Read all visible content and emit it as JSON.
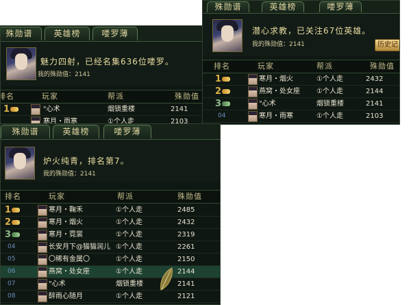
{
  "tabs": [
    "殊勋谱",
    "英雄榜",
    "喽罗薄"
  ],
  "headers": {
    "rank": "排名",
    "player": "玩家",
    "guild": "帮派",
    "value": "殊勋值"
  },
  "panel_a": {
    "message": "魅力四射，已经名集636位喽罗。",
    "my_value": "我的殊勋值：2141",
    "rows": [
      {
        "rank": "1",
        "player": "\"心术",
        "guild": "烟锁重楼",
        "value": "2141"
      },
      {
        "rank": "",
        "player": "寒月・雨寒",
        "guild": "①个人走",
        "value": "2103"
      }
    ]
  },
  "panel_b": {
    "message": "潜心求教，已关注67位英雄。",
    "my_value": "我的殊勋值：2141",
    "history_button": "历史记",
    "rows": [
      {
        "rank": "1",
        "player": "寒月・烟火",
        "guild": "①个人走",
        "value": "2432"
      },
      {
        "rank": "2",
        "player": "燕窝・处女座",
        "guild": "①个人走",
        "value": "2144"
      },
      {
        "rank": "3",
        "player": "\"心术",
        "guild": "烟锁重楼",
        "value": "2141"
      },
      {
        "rank": "04",
        "player": "寒月・雨寒",
        "guild": "①个人走",
        "value": "2103"
      }
    ]
  },
  "panel_c": {
    "message": "炉火纯青，排名第7。",
    "my_value": "我的殊勋值：2141",
    "rows": [
      {
        "rank": "1",
        "player": "寒月・鞠禾",
        "guild": "①个人走",
        "value": "2485"
      },
      {
        "rank": "2",
        "player": "寒月・烟火",
        "guild": "①个人走",
        "value": "2432"
      },
      {
        "rank": "3",
        "player": "寒月・霓裳",
        "guild": "①个人走",
        "value": "2319"
      },
      {
        "rank": "04",
        "player": "长安月下@猫猫润儿",
        "guild": "①个人走",
        "value": "2261"
      },
      {
        "rank": "05",
        "player": "〇稀有金属〇",
        "guild": "①个人走",
        "value": "2150"
      },
      {
        "rank": "06",
        "player": "燕窝・处女座",
        "guild": "①个人走",
        "value": "2144"
      },
      {
        "rank": "07",
        "player": "\"心术",
        "guild": "烟锁重楼",
        "value": "2141"
      },
      {
        "rank": "08",
        "player": "醉雨心随月",
        "guild": "①个人走",
        "value": "2121"
      }
    ]
  },
  "colors": {
    "panel_bg": "#0f1712",
    "text": "#e8e4d0",
    "gold": "#e7dca0",
    "rank_blue": "#6b8fbf",
    "highlight_row": "#1e4232"
  },
  "icons": [
    "portrait-icon",
    "gold-medal-icon",
    "silver-medal-icon",
    "bronze-medal-icon",
    "player-portrait-icon",
    "leaf-cursor-icon"
  ]
}
